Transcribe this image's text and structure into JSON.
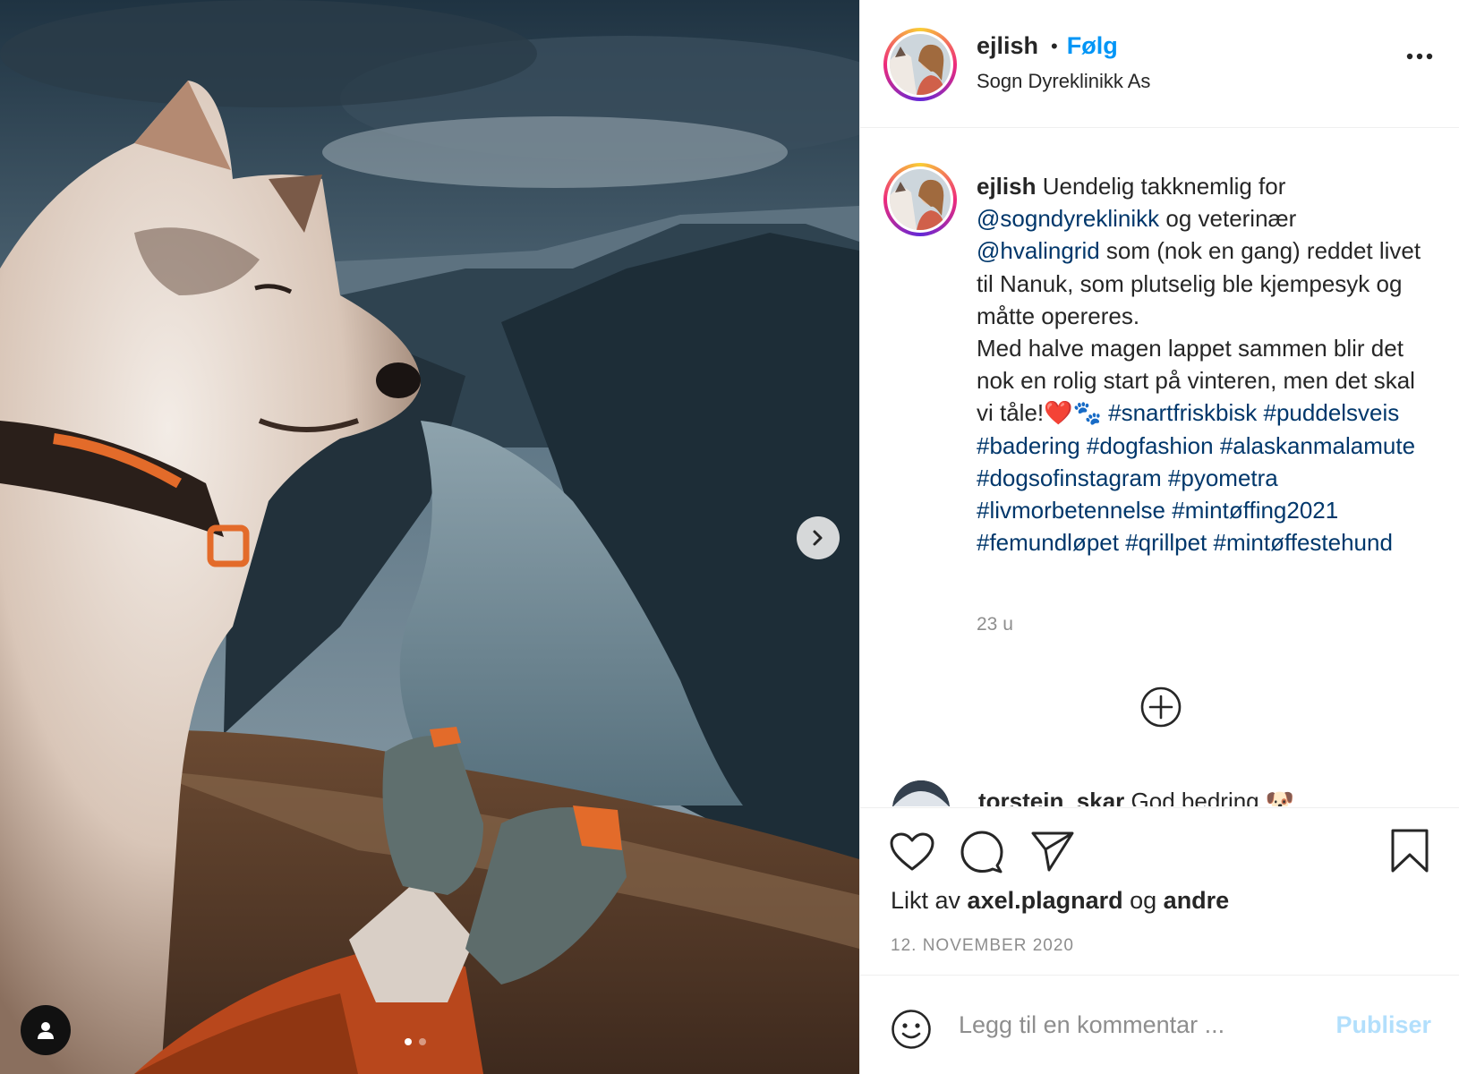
{
  "media": {
    "alt": "Husky sitting on a mountain edge overlooking a fjord",
    "carousel_dots": 2,
    "active_dot": 0
  },
  "header": {
    "username": "ejlish",
    "separator": "•",
    "follow_label": "Følg",
    "location": "Sogn Dyreklinikk As"
  },
  "caption": {
    "username": "ejlish",
    "text_1": " Uendelig takknemlig for ",
    "mention_1": "@sogndyreklinikk",
    "text_2": " og veterinær ",
    "mention_2": "@hvalingrid",
    "text_3": " som (nok en gang) reddet livet til Nanuk, som plutselig ble kjempesyk og måtte opereres.",
    "text_4": "Med halve magen lappet sammen blir det nok en rolig start på vinteren, men det skal vi tåle!❤️🐾 ",
    "hashtags": [
      "#snartfriskbisk",
      "#puddelsveis",
      "#badering",
      "#dogfashion",
      "#alaskanmalamute",
      "#dogsofinstagram",
      "#pyometra",
      "#livmorbetennelse",
      "#mintøffing2021",
      "#femundløpet",
      "#qrillpet",
      "#mintøffestehund"
    ],
    "time_ago": "23 u"
  },
  "next_comment": {
    "username": "torstein_skar",
    "text": " God bedring 🐶"
  },
  "actions": {
    "likes_prefix": "Likt av ",
    "likes_user": "axel.plagnard",
    "likes_mid": " og ",
    "likes_others": "andre",
    "date": "12. NOVEMBER 2020"
  },
  "comment_box": {
    "placeholder": "Legg til en kommentar ...",
    "publish_label": "Publiser"
  },
  "colors": {
    "link": "#00376b",
    "follow": "#0095f6",
    "publish_disabled": "#b2dffc",
    "secondary_text": "#8e8e8e"
  }
}
